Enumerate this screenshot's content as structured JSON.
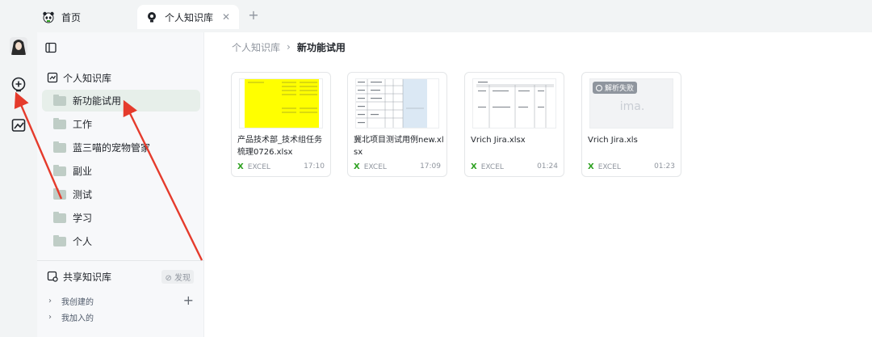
{
  "tabs": [
    {
      "label": "首页",
      "icon": "panda-icon"
    },
    {
      "label": "个人知识库",
      "icon": "bulb-icon",
      "close": "✕"
    }
  ],
  "tab_add": "+",
  "sidebar": {
    "personal_title": "个人知识库",
    "folders": [
      "新功能试用",
      "工作",
      "蓝三喵的宠物管家",
      "副业",
      "测试",
      "学习",
      "个人"
    ],
    "shared_title": "共享知识库",
    "discover_badge": "⊘ 发现",
    "created": "我创建的",
    "joined": "我加入的",
    "add": "+"
  },
  "breadcrumb": {
    "parent": "个人知识库",
    "separator": "›",
    "current": "新功能试用"
  },
  "files": [
    {
      "name": "产品技术部_技术组任务梳理0726.xlsx",
      "type": "EXCEL",
      "time": "17:10"
    },
    {
      "name": "冀北项目测试用例new.xlsx",
      "type": "EXCEL",
      "time": "17:09"
    },
    {
      "name": "Vrich Jira.xlsx",
      "type": "EXCEL",
      "time": "01:24"
    },
    {
      "name": "Vrich Jira.xls",
      "type": "EXCEL",
      "time": "01:23",
      "status": "解析失败",
      "logo": "ima."
    }
  ],
  "colors": {
    "accent": "#2ea121",
    "active_folder": "#e7efea",
    "annotation": "#e53b2c",
    "yellow_thumb": "#ffff00"
  }
}
